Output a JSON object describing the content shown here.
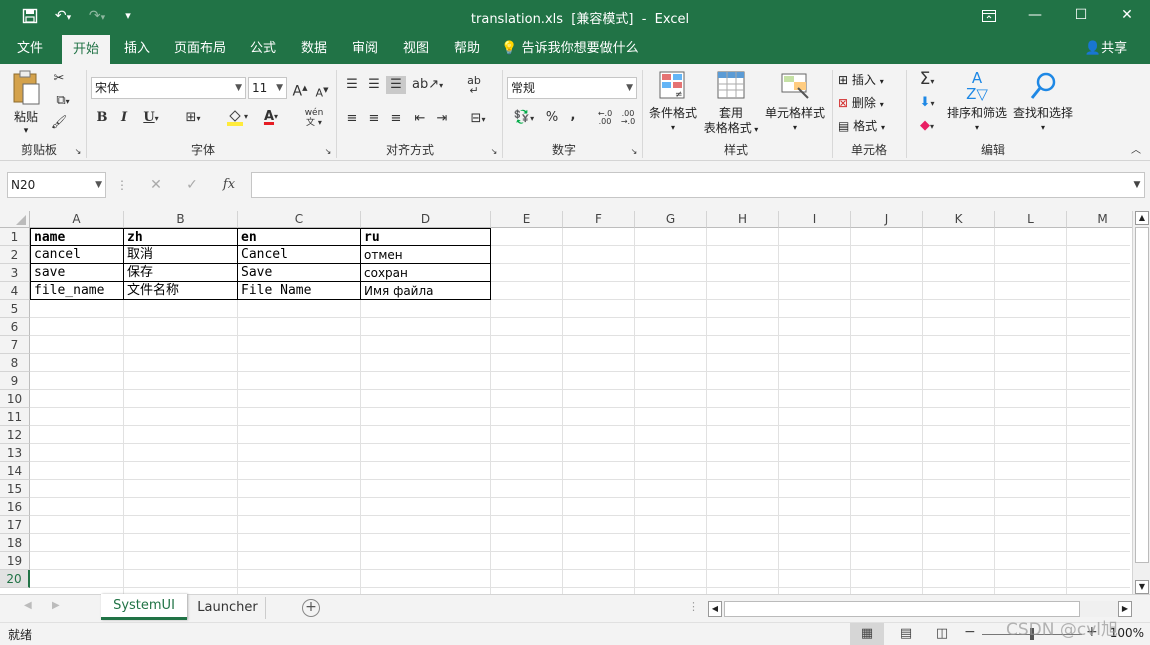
{
  "title": {
    "text": "translation.xls  [兼容模式]  -  Excel"
  },
  "quick_access": {
    "customize": "▾"
  },
  "tabs": [
    {
      "label": "文件"
    },
    {
      "label": "开始"
    },
    {
      "label": "插入"
    },
    {
      "label": "页面布局"
    },
    {
      "label": "公式"
    },
    {
      "label": "数据"
    },
    {
      "label": "审阅"
    },
    {
      "label": "视图"
    },
    {
      "label": "帮助"
    }
  ],
  "tellme": {
    "label": "告诉我你想要做什么"
  },
  "share": {
    "label": "共享"
  },
  "ribbon": {
    "clipboard": {
      "paste_label": "粘贴",
      "group_label": "剪贴板"
    },
    "font": {
      "name": "宋体",
      "size": "11",
      "bold": "B",
      "italic": "I",
      "underline": "U",
      "grow": "A",
      "shrink": "A",
      "font_color": "A",
      "phonetic": "wén",
      "group_label": "字体",
      "fill_color": "#ffeb3b",
      "text_color": "#e51c23"
    },
    "alignment": {
      "group_label": "对齐方式"
    },
    "number": {
      "format": "常规",
      "percent": "%",
      "comma": ",",
      "inc_decimal": "←.0 .00",
      "dec_decimal": ".00 →.0",
      "group_label": "数字"
    },
    "styles": {
      "conditional": "条件格式",
      "table_line1": "套用",
      "table_line2": "表格格式",
      "cell_styles": "单元格样式",
      "group_label": "样式"
    },
    "cells": {
      "insert": "插入",
      "delete": "删除",
      "format": "格式",
      "group_label": "单元格"
    },
    "editing": {
      "sort_filter": "排序和筛选",
      "find_select": "查找和选择",
      "group_label": "编辑"
    }
  },
  "formula_bar": {
    "name_box": "N20",
    "fx": "fx",
    "value": ""
  },
  "grid": {
    "columns": [
      "A",
      "B",
      "C",
      "D",
      "E",
      "F",
      "G",
      "H",
      "I",
      "J",
      "K",
      "L",
      "M"
    ],
    "rows": [
      "1",
      "2",
      "3",
      "4",
      "5",
      "6",
      "7",
      "8",
      "9",
      "10",
      "11",
      "12",
      "13",
      "14",
      "15",
      "16",
      "17",
      "18",
      "19",
      "20"
    ],
    "cells": [
      [
        "name",
        "zh",
        "en",
        "ru"
      ],
      [
        "cancel",
        "取消",
        "Cancel",
        "отмен"
      ],
      [
        "save",
        "保存",
        "Save",
        "сохран"
      ],
      [
        "file_name",
        "文件名称",
        "File Name",
        "Имя файла"
      ]
    ]
  },
  "sheets": {
    "tabs": [
      {
        "label": "SystemUI"
      },
      {
        "label": "Launcher"
      }
    ],
    "active": "SystemUI"
  },
  "status": {
    "ready": "就绪",
    "zoom": "100%",
    "watermark": "CSDN @cvl旭"
  },
  "colors": {
    "brand": "#217346",
    "ribbon_bg": "#f3f3f3",
    "active_sheet": "#217346"
  }
}
